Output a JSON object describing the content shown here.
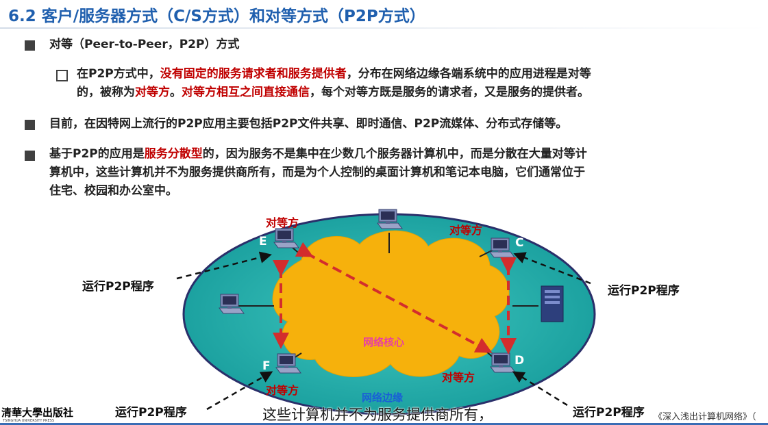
{
  "header": {
    "title": "6.2 客户/服务器方式（C/S方式）和对等方式（P2P方式）"
  },
  "bullets": {
    "b1": {
      "label": "对等（Peer-to-Peer，P2P）方式"
    },
    "b1_sub": {
      "p1": "在P2P方式中，",
      "r1": "没有固定的服务请求者和服务提供者",
      "p2": "，分布在网络边缘各端系统中的应用进程是对等",
      "p3": "的，被称为",
      "r2": "对等方",
      "p4": "。",
      "r3": "对等方相互之间直接通信",
      "p5": "，每个对等方既是服务的请求者，又是服务的提供者。"
    },
    "b2": {
      "text": "目前，在因特网上流行的P2P应用主要包括P2P文件共享、即时通信、P2P流媒体、分布式存储等。"
    },
    "b3": {
      "p1": "基于P2P的应用是",
      "r1": "服务分散型",
      "p2": "的，因为服务不是集中在少数几个服务器计算机中，而是分散在大量对等计",
      "line2": "算机中，这些计算机并不为服务提供商所有，而是为个人控制的桌面计算机和笔记本电脑，它们通常位于",
      "line3": "住宅、校园和办公室中。"
    }
  },
  "diagram": {
    "core_label": "网络核心",
    "edge_label": "网络边缘",
    "peer_label": "对等方",
    "run_label": "运行P2P程序",
    "nodes": {
      "E": "E",
      "C": "C",
      "F": "F",
      "D": "D"
    }
  },
  "subtitle": "这些计算机并不为服务提供商所有，",
  "footer": {
    "publisher": "清華大學出版社",
    "publisher_en": "TSINGHUA UNIVERSITY PRESS",
    "book": "《深入浅出计算机网络》（"
  },
  "colors": {
    "title": "#1f5fae",
    "highlight": "#c00000",
    "edge_fill": "#1aaca8",
    "core_fill": "#f6b10c",
    "arrow": "#d32d2d"
  }
}
